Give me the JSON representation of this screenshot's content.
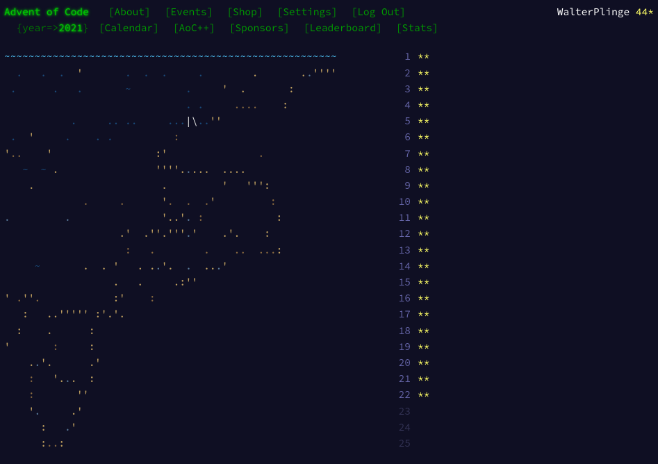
{
  "header": {
    "title": "Advent of Code",
    "sub_prefix": "{year=>",
    "year": "2021",
    "sub_suffix": "}",
    "nav_top": [
      {
        "label": "[About]"
      },
      {
        "label": "[Events]"
      },
      {
        "label": "[Shop]"
      },
      {
        "label": "[Settings]"
      },
      {
        "label": "[Log Out]"
      }
    ],
    "nav_bottom": [
      {
        "label": "[Calendar]"
      },
      {
        "label": "[AoC++]"
      },
      {
        "label": "[Sponsors]"
      },
      {
        "label": "[Leaderboard]"
      },
      {
        "label": "[Stats]"
      }
    ],
    "username": "WalterPlinge",
    "star_count": "44*"
  },
  "calendar": {
    "days": [
      {
        "day": 1,
        "stars": "**",
        "complete": true
      },
      {
        "day": 2,
        "stars": "**",
        "complete": true
      },
      {
        "day": 3,
        "stars": "**",
        "complete": true
      },
      {
        "day": 4,
        "stars": "**",
        "complete": true
      },
      {
        "day": 5,
        "stars": "**",
        "complete": true
      },
      {
        "day": 6,
        "stars": "**",
        "complete": true
      },
      {
        "day": 7,
        "stars": "**",
        "complete": true
      },
      {
        "day": 8,
        "stars": "**",
        "complete": true
      },
      {
        "day": 9,
        "stars": "**",
        "complete": true
      },
      {
        "day": 10,
        "stars": "**",
        "complete": true
      },
      {
        "day": 11,
        "stars": "**",
        "complete": true
      },
      {
        "day": 12,
        "stars": "**",
        "complete": true
      },
      {
        "day": 13,
        "stars": "**",
        "complete": true
      },
      {
        "day": 14,
        "stars": "**",
        "complete": true
      },
      {
        "day": 15,
        "stars": "**",
        "complete": true
      },
      {
        "day": 16,
        "stars": "**",
        "complete": true
      },
      {
        "day": 17,
        "stars": "**",
        "complete": true
      },
      {
        "day": 18,
        "stars": "**",
        "complete": true
      },
      {
        "day": 19,
        "stars": "**",
        "complete": true
      },
      {
        "day": 20,
        "stars": "**",
        "complete": true
      },
      {
        "day": 21,
        "stars": "**",
        "complete": true
      },
      {
        "day": 22,
        "stars": "**",
        "complete": true
      },
      {
        "day": 23,
        "stars": "",
        "complete": false
      },
      {
        "day": 24,
        "stars": "",
        "complete": false
      },
      {
        "day": 25,
        "stars": "",
        "complete": false
      }
    ]
  },
  "art_lines": [
    "~~~~~~~~~~~~~~~~~~~~~~~~~~~~~~~~~~~~~~~~~~~~~~~~~~~~~~~",
    "  .   .  .  '       .  .  .     .        .       ..''''",
    " .      .   .       ~         .     '  .       :       ",
    "                              . .     ....    :        ",
    "           .     .. ..     ...|\\..''          ",
    " .  '     .    . .          :                          ",
    "'..    '                 :'               .            ",
    "   ~  ~ .                ''''.....  ....               ",
    "    .                     .         '   ''':           ",
    "             .     .      '.  .  .'         :          ",
    ".         .               '..'. :            :         ",
    "                   .'  .''.'''.'    .'.    :           ",
    "                    :   .        .    ..  ...:         ",
    "     ~       .  . '   . ..'.  .  ...'                  ",
    "                  .   .     .:''                       ",
    "' .''.            :'    :                              ",
    "   :   ..''''' :'.'.                                   ",
    "  :    .      :                                        ",
    "'       :     :                                        ",
    "    ..'.      .'                                       ",
    "    :   '...  :                                        ",
    "    :       ''                                         ",
    "    '.     .'                                          ",
    "      :   .'                                           ",
    "      :..:                                             "
  ]
}
